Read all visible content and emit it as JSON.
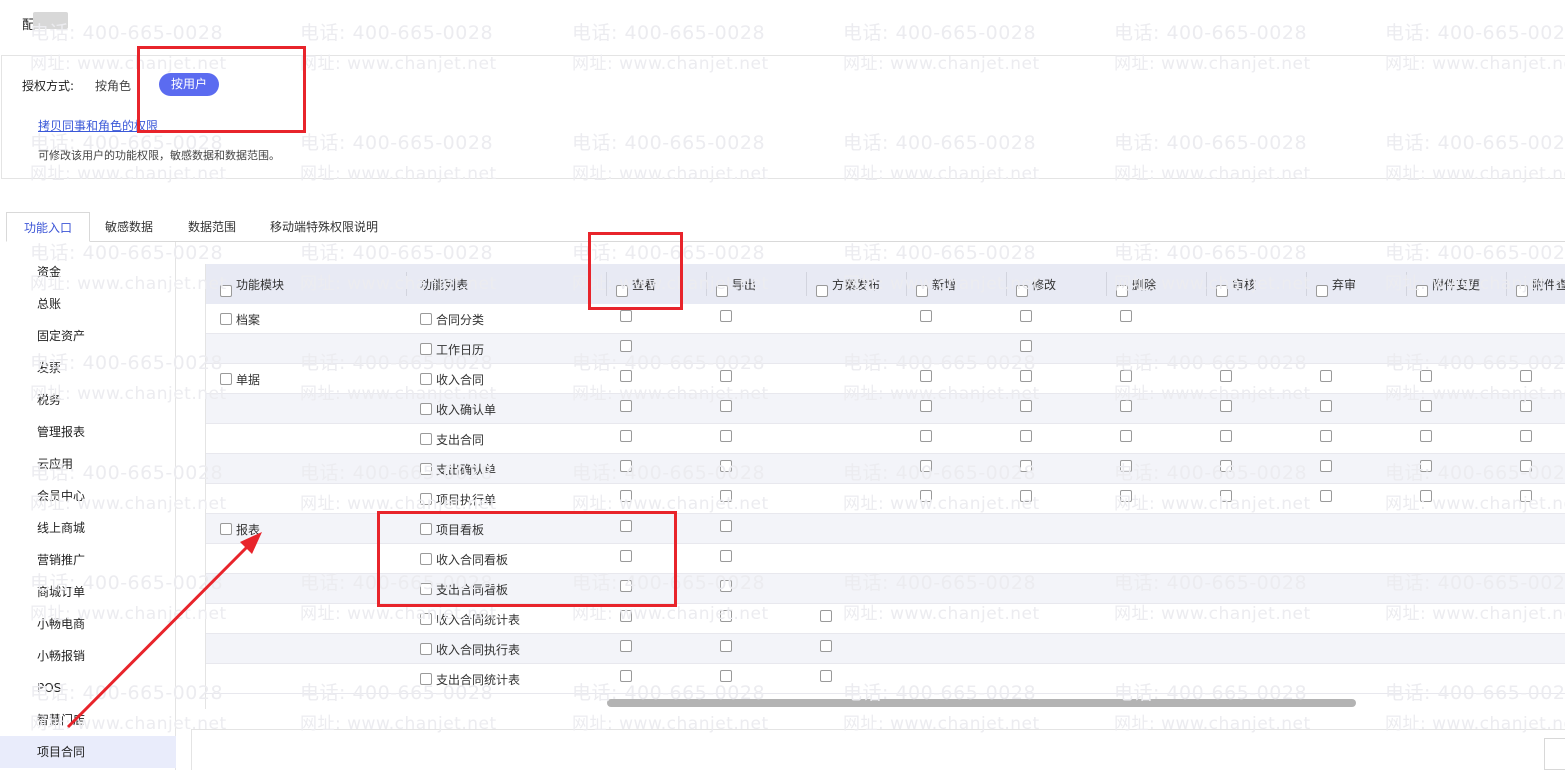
{
  "header": {
    "title_char": "配"
  },
  "auth": {
    "label": "授权方式:",
    "option_role": "按角色",
    "option_user": "按用户"
  },
  "copy_link": "拷贝同事和角色的权限",
  "hint": "可修改该用户的功能权限，敏感数据和数据范围。",
  "tabs": [
    "功能入口",
    "敏感数据",
    "数据范围",
    "移动端特殊权限说明"
  ],
  "sidebar": {
    "items": [
      "资金",
      "总账",
      "固定资产",
      "发票",
      "税务",
      "管理报表",
      "云应用",
      "会员中心",
      "线上商城",
      "营销推广",
      "商城订单",
      "小畅电商",
      "小畅报销",
      "POS",
      "智慧门店",
      "项目合同"
    ],
    "active": "项目合同"
  },
  "table": {
    "headers": {
      "module": "功能模块",
      "function": "功能列表",
      "perms": [
        "查看",
        "导出",
        "方案发布",
        "新增",
        "修改",
        "删除",
        "审核",
        "弃审",
        "附件变更",
        "附件查"
      ]
    },
    "rows": [
      {
        "module": "档案",
        "function": "合同分类",
        "checks": [
          1,
          1,
          0,
          1,
          1,
          1,
          0,
          0,
          0,
          0
        ]
      },
      {
        "module": "",
        "function": "工作日历",
        "checks": [
          1,
          0,
          0,
          0,
          1,
          0,
          0,
          0,
          0,
          0
        ]
      },
      {
        "module": "单据",
        "function": "收入合同",
        "checks": [
          1,
          1,
          0,
          1,
          1,
          1,
          1,
          1,
          1,
          1
        ]
      },
      {
        "module": "",
        "function": "收入确认单",
        "checks": [
          1,
          1,
          0,
          1,
          1,
          1,
          1,
          1,
          1,
          1
        ]
      },
      {
        "module": "",
        "function": "支出合同",
        "checks": [
          1,
          1,
          0,
          1,
          1,
          1,
          1,
          1,
          1,
          1
        ]
      },
      {
        "module": "",
        "function": "支出确认单",
        "checks": [
          1,
          1,
          0,
          1,
          1,
          1,
          1,
          1,
          1,
          1
        ]
      },
      {
        "module": "",
        "function": "项目执行单",
        "checks": [
          1,
          1,
          0,
          1,
          1,
          1,
          1,
          1,
          1,
          1
        ]
      },
      {
        "module": "报表",
        "function": "项目看板",
        "checks": [
          1,
          1,
          0,
          0,
          0,
          0,
          0,
          0,
          0,
          0
        ]
      },
      {
        "module": "",
        "function": "收入合同看板",
        "checks": [
          1,
          1,
          0,
          0,
          0,
          0,
          0,
          0,
          0,
          0
        ]
      },
      {
        "module": "",
        "function": "支出合同看板",
        "checks": [
          1,
          1,
          0,
          0,
          0,
          0,
          0,
          0,
          0,
          0
        ]
      },
      {
        "module": "",
        "function": "收入合同统计表",
        "checks": [
          1,
          1,
          1,
          0,
          0,
          0,
          0,
          0,
          0,
          0
        ]
      },
      {
        "module": "",
        "function": "收入合同执行表",
        "checks": [
          1,
          1,
          1,
          0,
          0,
          0,
          0,
          0,
          0,
          0
        ]
      },
      {
        "module": "",
        "function": "支出合同统计表",
        "checks": [
          1,
          1,
          1,
          0,
          0,
          0,
          0,
          0,
          0,
          0
        ]
      }
    ]
  },
  "watermark": {
    "phone": "电话: 400-665-0028",
    "web": "网址: www.chanjet.net"
  },
  "colors": {
    "accent": "#5b6bf0",
    "link": "#3a58d8",
    "annotation": "#e8242b",
    "header_bg": "#e8eaf4"
  }
}
